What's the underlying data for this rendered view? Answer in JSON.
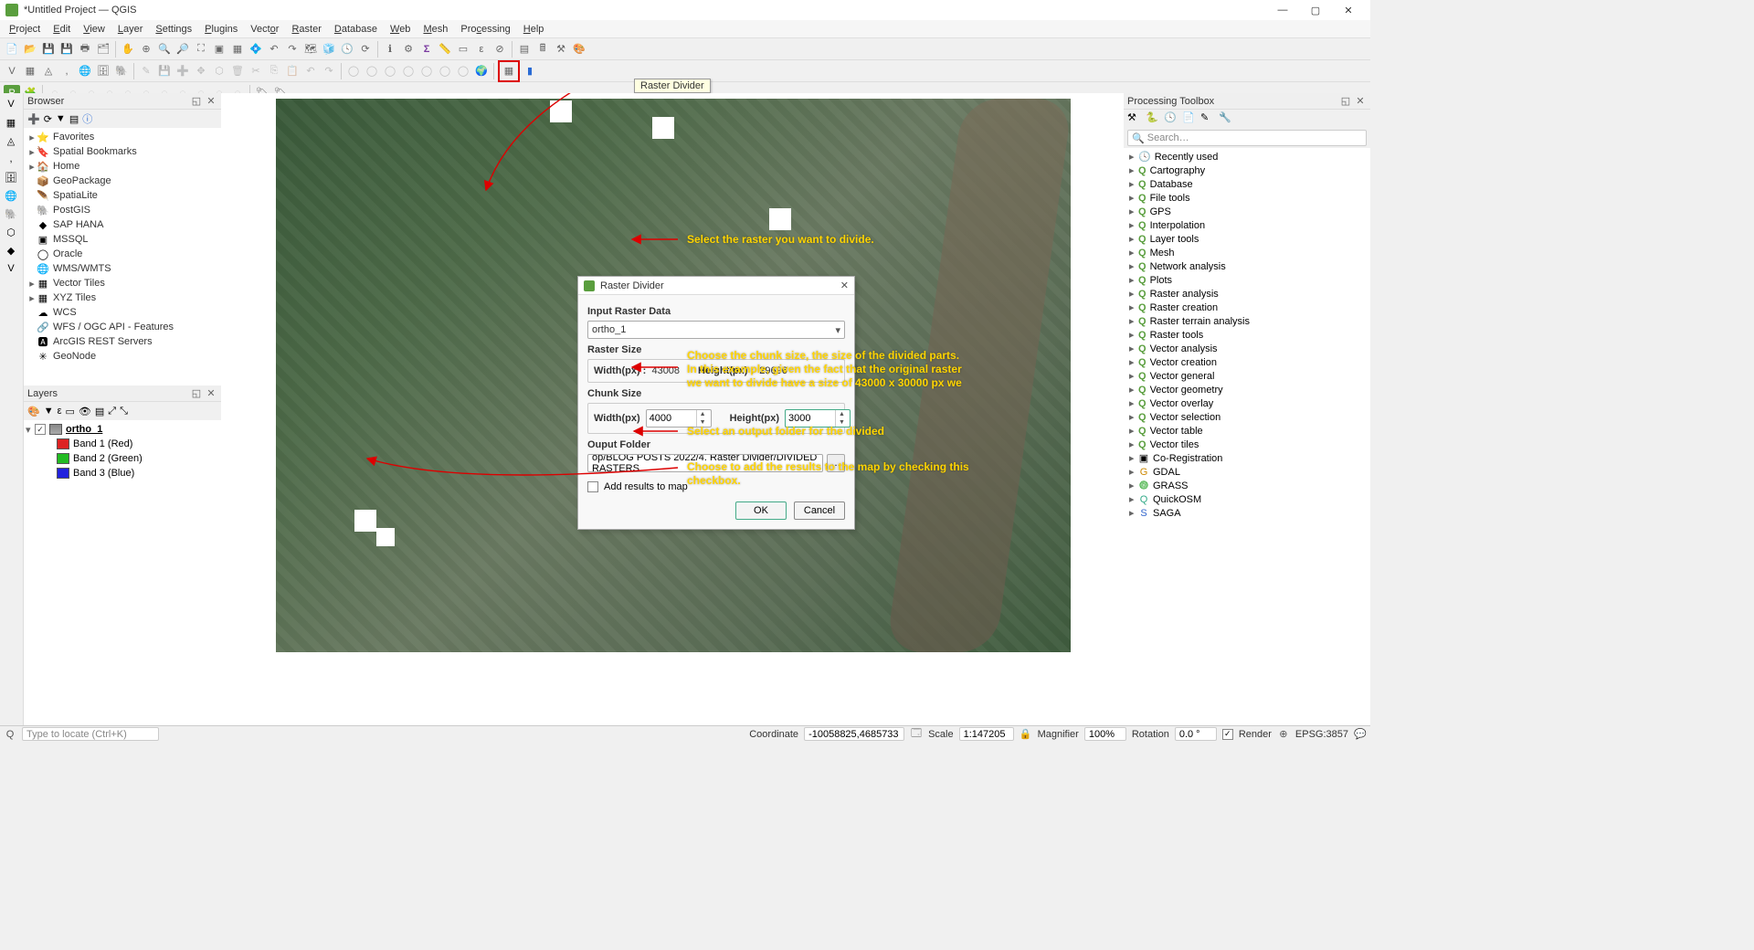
{
  "window": {
    "title": "*Untitled Project — QGIS"
  },
  "menu": [
    "Project",
    "Edit",
    "View",
    "Layer",
    "Settings",
    "Plugins",
    "Vector",
    "Raster",
    "Database",
    "Web",
    "Mesh",
    "Processing",
    "Help"
  ],
  "tooltip": "Raster Divider",
  "browser": {
    "title": "Browser",
    "items": [
      {
        "icon": "star",
        "label": "Favorites",
        "exp": "▸"
      },
      {
        "icon": "bookmark",
        "label": "Spatial Bookmarks",
        "exp": "▸"
      },
      {
        "icon": "home",
        "label": "Home",
        "exp": "▸"
      },
      {
        "icon": "geopackage",
        "label": "GeoPackage",
        "exp": ""
      },
      {
        "icon": "spatialite",
        "label": "SpatiaLite",
        "exp": ""
      },
      {
        "icon": "postgis",
        "label": "PostGIS",
        "exp": ""
      },
      {
        "icon": "saphana",
        "label": "SAP HANA",
        "exp": ""
      },
      {
        "icon": "mssql",
        "label": "MSSQL",
        "exp": ""
      },
      {
        "icon": "oracle",
        "label": "Oracle",
        "exp": ""
      },
      {
        "icon": "wms",
        "label": "WMS/WMTS",
        "exp": ""
      },
      {
        "icon": "vectortiles",
        "label": "Vector Tiles",
        "exp": "▸"
      },
      {
        "icon": "xyz",
        "label": "XYZ Tiles",
        "exp": "▸"
      },
      {
        "icon": "wcs",
        "label": "WCS",
        "exp": ""
      },
      {
        "icon": "wfs",
        "label": "WFS / OGC API - Features",
        "exp": ""
      },
      {
        "icon": "arcgis",
        "label": "ArcGIS REST Servers",
        "exp": ""
      },
      {
        "icon": "geonode",
        "label": "GeoNode",
        "exp": ""
      }
    ]
  },
  "layers": {
    "title": "Layers",
    "root": {
      "label": "ortho_1",
      "checked": true
    },
    "bands": [
      {
        "color": "#d22",
        "label": "Band 1 (Red)"
      },
      {
        "color": "#2b2",
        "label": "Band 2 (Green)"
      },
      {
        "color": "#22d",
        "label": "Band 3 (Blue)"
      }
    ]
  },
  "processing": {
    "title": "Processing Toolbox",
    "search_placeholder": "Search…",
    "groups": [
      {
        "icon": "clock",
        "label": "Recently used"
      },
      {
        "icon": "q",
        "label": "Cartography"
      },
      {
        "icon": "q",
        "label": "Database"
      },
      {
        "icon": "q",
        "label": "File tools"
      },
      {
        "icon": "q",
        "label": "GPS"
      },
      {
        "icon": "q",
        "label": "Interpolation"
      },
      {
        "icon": "q",
        "label": "Layer tools"
      },
      {
        "icon": "q",
        "label": "Mesh"
      },
      {
        "icon": "q",
        "label": "Network analysis"
      },
      {
        "icon": "q",
        "label": "Plots"
      },
      {
        "icon": "q",
        "label": "Raster analysis"
      },
      {
        "icon": "q",
        "label": "Raster creation"
      },
      {
        "icon": "q",
        "label": "Raster terrain analysis"
      },
      {
        "icon": "q",
        "label": "Raster tools"
      },
      {
        "icon": "q",
        "label": "Vector analysis"
      },
      {
        "icon": "q",
        "label": "Vector creation"
      },
      {
        "icon": "q",
        "label": "Vector general"
      },
      {
        "icon": "q",
        "label": "Vector geometry"
      },
      {
        "icon": "q",
        "label": "Vector overlay"
      },
      {
        "icon": "q",
        "label": "Vector selection"
      },
      {
        "icon": "q",
        "label": "Vector table"
      },
      {
        "icon": "q",
        "label": "Vector tiles"
      },
      {
        "icon": "prov",
        "label": "Co-Registration"
      },
      {
        "icon": "gdal",
        "label": "GDAL"
      },
      {
        "icon": "grass",
        "label": "GRASS"
      },
      {
        "icon": "qosm",
        "label": "QuickOSM"
      },
      {
        "icon": "saga",
        "label": "SAGA"
      }
    ]
  },
  "dialog": {
    "title": "Raster Divider",
    "input_label": "Input Raster Data",
    "input_value": "ortho_1",
    "raster_size_label": "Raster Size",
    "width_label": "Width(px) :",
    "height_label": "Height(px) :",
    "raster_width": "43008",
    "raster_height": "29696",
    "chunk_size_label": "Chunk Size",
    "chunk_width_label": "Width(px)",
    "chunk_height_label": "Height(px)",
    "chunk_width": "4000",
    "chunk_height": "3000",
    "output_label": "Ouput Folder",
    "output_value": "op/BLOG POSTS 2022/4. Raster Divider/DIVIDED RASTERS",
    "add_results_label": "Add results to map",
    "ok": "OK",
    "cancel": "Cancel"
  },
  "annotations": {
    "a1": "Select the raster you want to divide.",
    "a2": "Choose the chunk size, the size of the divided parts.\nIn this example, given the fact that the original raster\nwe want to divide have a size of 43000 x 30000 px we",
    "a3": "Select an output folder for the divided",
    "a4": "Choose to add the results to the map by checking this\ncheckbox."
  },
  "status": {
    "locate_placeholder": "Type to locate (Ctrl+K)",
    "coord_label": "Coordinate",
    "coord_value": "-10058825,4685733",
    "scale_label": "Scale",
    "scale_value": "1:147205",
    "mag_label": "Magnifier",
    "mag_value": "100%",
    "rot_label": "Rotation",
    "rot_value": "0.0 °",
    "render_label": "Render",
    "crs": "EPSG:3857"
  }
}
